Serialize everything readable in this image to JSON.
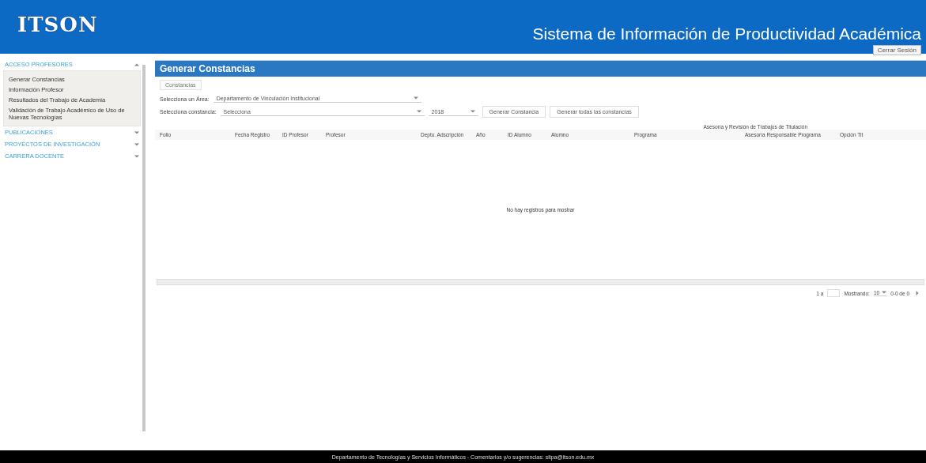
{
  "header": {
    "logo": "ITSON",
    "title": "Sistema de Información de Productividad Académica",
    "logout": "Cerrar Sesión"
  },
  "sidebar": {
    "sections": [
      {
        "label": "ACCESO PROFESORES",
        "expanded": true,
        "items": [
          {
            "label": "Generar Constancias"
          },
          {
            "label": "Información Profesor"
          },
          {
            "label": "Resultados del Trabajo de Academia"
          },
          {
            "label": "Validación de Trabajo Académico de Uso de Nuevas Tecnologías"
          }
        ]
      },
      {
        "label": "PUBLICACIONES",
        "expanded": false
      },
      {
        "label": "PROYECTOS DE INVESTIGACIÓN",
        "expanded": false
      },
      {
        "label": "CARRERA DOCENTE",
        "expanded": false
      }
    ]
  },
  "panel": {
    "title": "Generar Constancias",
    "tabs": [
      {
        "label": "Constancias",
        "selected": true
      }
    ],
    "area": {
      "label": "Selecciona un Área:",
      "value": "Departamento de Vinculación Institucional"
    },
    "constancia": {
      "label": "Selecciona constancia:",
      "value": "Selecciona",
      "year": "2018"
    },
    "buttons": [
      "Generar Constancia",
      "Generar todas las constancias"
    ],
    "table": {
      "group_header": "Asesoría y Revisión de Trabajos de Titulación",
      "columns": [
        "Folio",
        "Fecha Registro",
        "ID Profesor",
        "Profesor",
        "Depto. Adscripción",
        "Año",
        "ID Alumno",
        "Alumno",
        "Programa",
        "Asesoría Responsable Programa",
        "Opción Tit"
      ],
      "empty_message": "No hay registros para mostrar"
    },
    "pager": {
      "page_label": "1 a",
      "showing_label": "Mostrando:",
      "page_size": "10",
      "range": "0-0 de 0"
    }
  },
  "footer": "Departamento de Tecnologías y Servicios Informáticos - Comentarios y/o sugerencias: sitpa@itson.edu.mx"
}
